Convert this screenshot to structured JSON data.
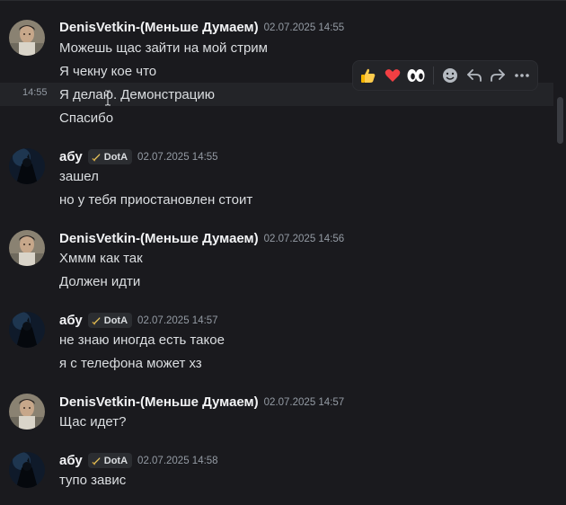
{
  "messages": [
    {
      "author": "DenisVetkin-(Меньше Думаем)",
      "timestamp": "02.07.2025 14:55",
      "lines": [
        "Можешь щас зайти на мой стрим",
        "Я чекну кое что",
        "Я делаю. Демонстрацию",
        "Спасибо"
      ],
      "hover_timestamp": "14:55"
    },
    {
      "author": "абу",
      "tag": "DotA",
      "timestamp": "02.07.2025 14:55",
      "lines": [
        "зашел",
        "но у тебя приостановлен стоит"
      ]
    },
    {
      "author": "DenisVetkin-(Меньше Думаем)",
      "timestamp": "02.07.2025 14:56",
      "lines": [
        "Хммм как так",
        "Должен идти"
      ]
    },
    {
      "author": "абу",
      "tag": "DotA",
      "timestamp": "02.07.2025 14:57",
      "lines": [
        "не знаю иногда есть такое",
        "я с телефона может хз"
      ]
    },
    {
      "author": "DenisVetkin-(Меньше Думаем)",
      "timestamp": "02.07.2025 14:57",
      "lines": [
        "Щас идет?"
      ]
    },
    {
      "author": "абу",
      "tag": "DotA",
      "timestamp": "02.07.2025 14:58",
      "lines": [
        "тупо завис"
      ]
    }
  ],
  "toolbar": {
    "reactions": [
      "thumbs-up-emoji",
      "red-heart-emoji",
      "eyes-emoji"
    ],
    "actions": [
      "add-reaction-icon",
      "reply-icon",
      "forward-icon",
      "more-options-icon"
    ]
  },
  "colors": {
    "background": "#1a1a1e",
    "text": "#dbdee1",
    "muted": "#949ba4",
    "heart": "#f23f43",
    "thumb": "#ffcc4d"
  }
}
